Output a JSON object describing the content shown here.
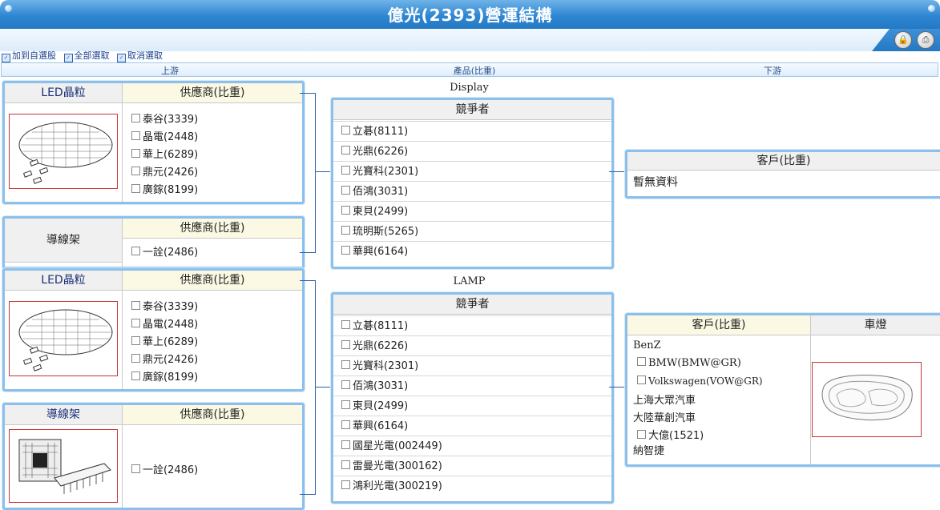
{
  "title": "億光(2393)營運結構",
  "toolbar": {
    "lock_icon": "lock-icon",
    "print_icon": "printer-icon"
  },
  "actions": [
    "加到自選股",
    "全部選取",
    "取消選取"
  ],
  "columns": {
    "upstream": "上游",
    "product": "產品(比重)",
    "downstream": "下游"
  },
  "supplier_header": "供應商(比重)",
  "competitor_header": "競爭者",
  "customer_header": "客戶(比重)",
  "sections": [
    {
      "product": "Display",
      "upstream": [
        {
          "category": "LED晶粒",
          "image": "led-wafer",
          "suppliers": [
            "泰谷(3339)",
            "晶電(2448)",
            "華上(6289)",
            "鼎元(2426)",
            "廣鎵(8199)"
          ]
        },
        {
          "category": "導線架",
          "image": "",
          "suppliers": [
            "一詮(2486)"
          ]
        }
      ],
      "competitors": [
        "立碁(8111)",
        "光鼎(6226)",
        "光寶科(2301)",
        "佰鴻(3031)",
        "東貝(2499)",
        "琉明斯(5265)",
        "華興(6164)"
      ],
      "customers": {
        "no_data": "暫無資料"
      }
    },
    {
      "product": "LAMP",
      "upstream": [
        {
          "category": "LED晶粒",
          "image": "led-wafer",
          "suppliers": [
            "泰谷(3339)",
            "晶電(2448)",
            "華上(6289)",
            "鼎元(2426)",
            "廣鎵(8199)"
          ]
        },
        {
          "category": "導線架",
          "image": "lead-frame-chip",
          "suppliers": [
            "一詮(2486)"
          ]
        }
      ],
      "competitors": [
        "立碁(8111)",
        "光鼎(6226)",
        "光寶科(2301)",
        "佰鴻(3031)",
        "東貝(2499)",
        "華興(6164)",
        "國星光電(002449)",
        "雷曼光電(300162)",
        "鴻利光電(300219)"
      ],
      "customers": {
        "category": "車燈",
        "image": "car-lamp",
        "entries": [
          {
            "label": "BenZ",
            "checkbox": false
          },
          {
            "label": "BMW(BMW@GR)",
            "checkbox": true
          },
          {
            "label": "Volkswagen(VOW@GR)",
            "checkbox": true
          },
          {
            "label": "上海大眾汽車",
            "checkbox": false
          },
          {
            "label": "大陸華創汽車",
            "checkbox": false
          },
          {
            "label": "大億(1521)",
            "checkbox": true
          },
          {
            "label": "納智捷",
            "checkbox": false
          }
        ]
      }
    }
  ],
  "colors": {
    "title_bar": "#2e86d2",
    "box_border": "#8cc0eb",
    "connector": "#2a5fa8",
    "image_border": "#cc3333"
  }
}
